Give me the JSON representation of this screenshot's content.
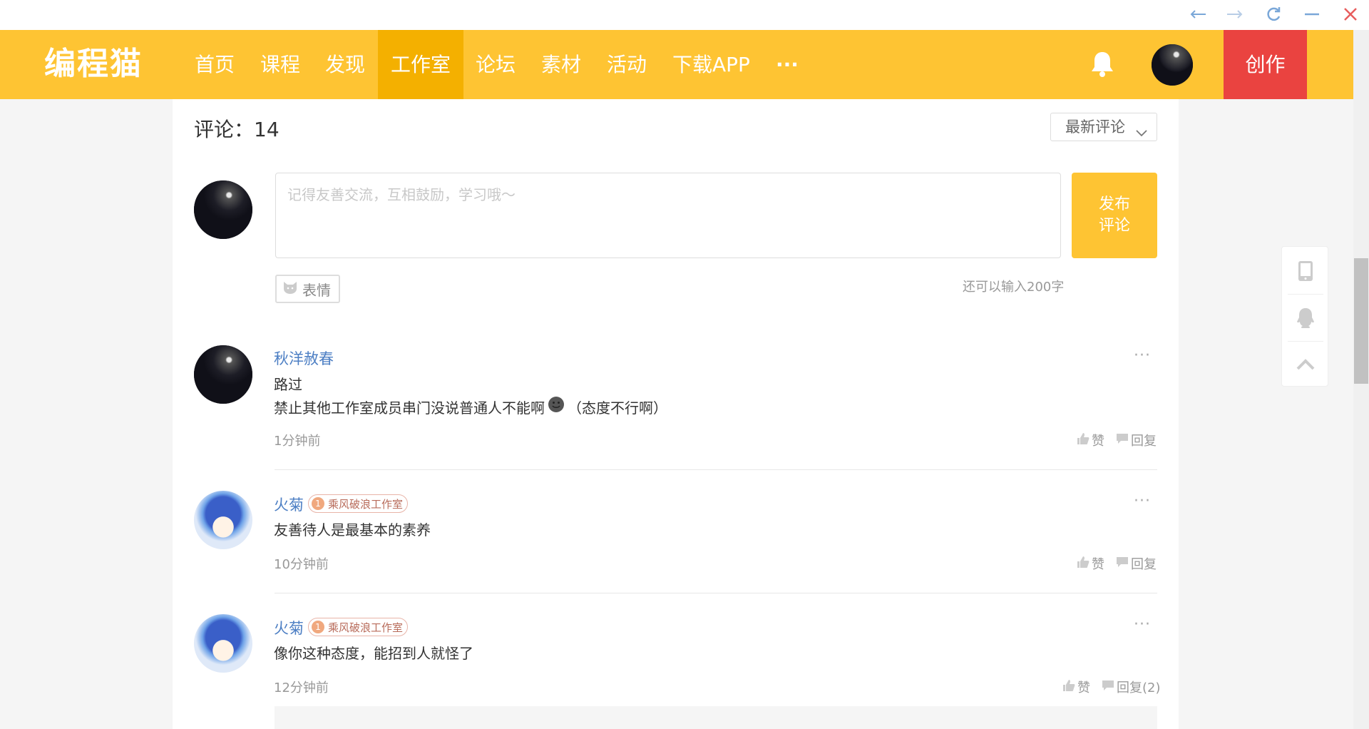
{
  "window": {
    "controls": [
      "back-icon",
      "forward-icon",
      "refresh-icon",
      "minimize-icon",
      "close-icon"
    ]
  },
  "nav": {
    "logo": "编程猫",
    "items": [
      {
        "label": "首页",
        "active": false
      },
      {
        "label": "课程",
        "active": false
      },
      {
        "label": "发现",
        "active": false
      },
      {
        "label": "工作室",
        "active": true
      },
      {
        "label": "论坛",
        "active": false
      },
      {
        "label": "素材",
        "active": false
      },
      {
        "label": "活动",
        "active": false
      },
      {
        "label": "下载APP",
        "active": false
      },
      {
        "label": "···",
        "active": false
      }
    ],
    "create_label": "创作",
    "bell_icon": "bell-icon",
    "colors": {
      "bar": "#fec433",
      "active": "#f4b000",
      "create": "#ea4340"
    }
  },
  "comments": {
    "title": "评论：14",
    "sort_label": "最新评论",
    "composer": {
      "placeholder": "记得友善交流，互相鼓励，学习哦～",
      "publish_label_1": "发布",
      "publish_label_2": "评论",
      "emoji_label": "表情",
      "char_count": "还可以输入200字"
    },
    "items": [
      {
        "name": "秋洋赦春",
        "line1": "路过",
        "line2": "禁止其他工作室成员串门没说普通人不能啊",
        "line2_suffix": "（态度不行啊）",
        "time": "1分钟前",
        "like_label": "赞",
        "reply_label": "回复"
      },
      {
        "name": "火菊",
        "badge_level": "1",
        "badge_text": "乘风破浪工作室",
        "line1": "友善待人是最基本的素养",
        "time": "10分钟前",
        "like_label": "赞",
        "reply_label": "回复"
      },
      {
        "name": "火菊",
        "badge_level": "1",
        "badge_text": "乘风破浪工作室",
        "line1": "像你这种态度，能招到人就怪了",
        "time": "12分钟前",
        "like_label": "赞",
        "reply_label": "回复(2)"
      }
    ],
    "more_label": "···"
  },
  "side_tools": [
    "tablet-icon",
    "qq-icon",
    "back-to-top-icon"
  ]
}
